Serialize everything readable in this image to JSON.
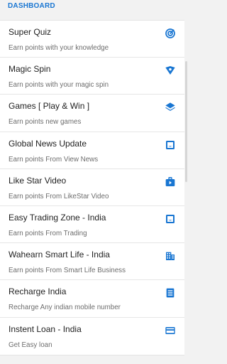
{
  "header": {
    "title": "DASHBOARD"
  },
  "items": [
    {
      "title": "Super Quiz",
      "subtitle": "Earn points with your knowledge",
      "icon": "quiz-target-icon"
    },
    {
      "title": "Magic Spin",
      "subtitle": "Earn points with your magic spin",
      "icon": "spin-shield-icon"
    },
    {
      "title": "Games [ Play & Win ]",
      "subtitle": "Earn points new games",
      "icon": "layers-icon"
    },
    {
      "title": "Global News Update",
      "subtitle": "Earn points From View News",
      "icon": "inbox-icon"
    },
    {
      "title": "Like Star Video",
      "subtitle": "Earn points From LikeStar Video",
      "icon": "video-case-icon"
    },
    {
      "title": "Easy Trading Zone - India",
      "subtitle": "Earn points From Trading",
      "icon": "inbox-icon"
    },
    {
      "title": "Wahearn Smart Life - India",
      "subtitle": "Earn points From Smart Life Business",
      "icon": "building-icon"
    },
    {
      "title": "Recharge India",
      "subtitle": "Recharge Any indian mobile number",
      "icon": "list-doc-icon"
    },
    {
      "title": "Instent Loan - India",
      "subtitle": "Get Easy loan",
      "icon": "credit-card-icon"
    }
  ],
  "colors": {
    "accent": "#1976d2"
  }
}
